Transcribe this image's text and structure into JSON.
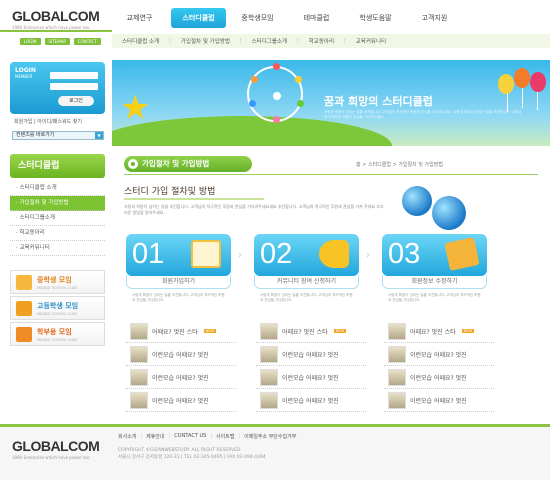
{
  "header": {
    "logo": "GLOBALCOM",
    "logo_sub": "1980 Enterprise which have power too",
    "util": [
      "LOGIN",
      "SITEMAP",
      "CONTACT"
    ],
    "gnb": [
      "교제연구",
      "스터디클럽",
      "중학생모임",
      "테마클럽",
      "학생도움말",
      "고객지원"
    ],
    "snb": [
      "스터디클럽 소개",
      "가입절차 및 가입방법",
      "스터디그룹소개",
      "학교동아리",
      "교육커뮤니티"
    ]
  },
  "login": {
    "title": "LOGIN",
    "sub": "MEMBER",
    "button": "로그인",
    "links": "회원가입 | 아이디/패스워드 찾기",
    "select": "컨텐츠를 바로가기"
  },
  "banner": {
    "title": "꿈과 희망의 스터디클럽",
    "sub": "사랑과 희망이 넘치는 일을 추진합니다. 고객님의 적극적인 후원과 관심을 기다려주세요. 사랑과 희망이 넘치는 일을 추진합니다. 고객님의 적극적인 후원과 관심을 기다려주세요."
  },
  "side": {
    "title": "스터디클럽",
    "menu": [
      "스터디클럽 소개",
      "가입절차 및 가입방법",
      "스터디그룹소개",
      "학교동아리",
      "교육커뮤니티"
    ],
    "banners": [
      {
        "title": "중학생 모임",
        "sub": "MIDDLE SCHOOL CLUB"
      },
      {
        "title": "고등학생 모임",
        "sub": "MIDDLE SCHOOL CLUB"
      },
      {
        "title": "학부용 모임",
        "sub": "MIDDLE SCHOOL CLUB"
      }
    ]
  },
  "content": {
    "section": "가입절차 및 가입방법",
    "breadcrumb": "홈 > 스터디클럽 > 가입절차 및 가입방법",
    "heading": "스터디 가입 절차및 방법",
    "desc": "사랑과 희망이 넘치는 일을 추진합니다. 고객님의 적극적인 후원과 관심을 기다려주세요세요 추진합니다. 고객님의 적극적인 후원과 관심을 가져 주세요 부끄러운 방법을 알아주세요.",
    "steps": [
      {
        "num": "01",
        "label": "회원가입하기",
        "text": "사랑과 희망이 넘치는 일을 추진합니다. 고객님의 적극적인 후원과 관심을 기다립니다."
      },
      {
        "num": "02",
        "label": "커뮤니티 참여 신청하기",
        "text": "사랑과 희망이 넘치는 일을 추진합니다. 고객님의 적극적인 후원과 관심을 기다립니다."
      },
      {
        "num": "03",
        "label": "회원정보 수정하기",
        "text": "사랑과 희망이 넘치는 일을 추진합니다. 고객님의 적극적인 후원과 관심을 기다립니다."
      }
    ],
    "list_rows": [
      "어때요? 멋진 스타",
      "이런모습 어때요? 멋진",
      "이런모습 어때요? 멋진",
      "이런모습 어때요? 멋진"
    ],
    "badge": "NEW"
  },
  "footer": {
    "links": [
      "회사소개",
      "제휴안내",
      "CONTACT US",
      "사이트맵",
      "이메일주소 무단수집거부"
    ],
    "copy1": "COPYRIGHT ©GIZANWEBSTUDY. ALL RIGHT RESERVED",
    "copy2": "서울시 강서구 강서동일 120-23 | TEL 02-345-0495 | FAX 02-094-0394"
  }
}
